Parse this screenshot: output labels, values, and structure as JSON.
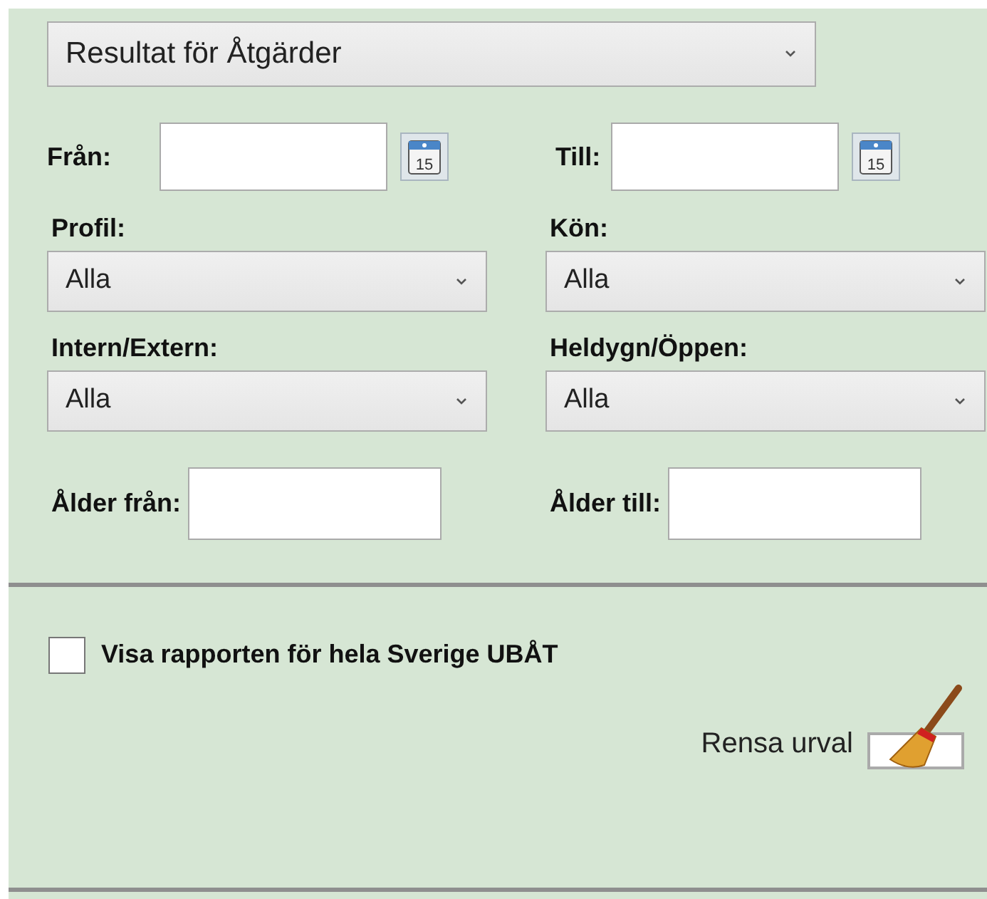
{
  "report_select": {
    "value": "Resultat för Åtgärder"
  },
  "dates": [
    {
      "label": "Från:",
      "calendar_day": "15"
    },
    {
      "label": "Till:",
      "calendar_day": "15"
    }
  ],
  "filters": [
    {
      "label": "Profil:",
      "value": "Alla"
    },
    {
      "label": "Kön:",
      "value": "Alla"
    },
    {
      "label": "Intern/Extern:",
      "value": "Alla"
    },
    {
      "label": "Heldygn/Öppen:",
      "value": "Alla"
    }
  ],
  "ages": [
    {
      "label": "Ålder från:"
    },
    {
      "label": "Ålder till:"
    }
  ],
  "whole_sweden": {
    "label": "Visa rapporten för hela Sverige UBÅT",
    "checked": false
  },
  "clear_button": {
    "label": "Rensa urval"
  }
}
